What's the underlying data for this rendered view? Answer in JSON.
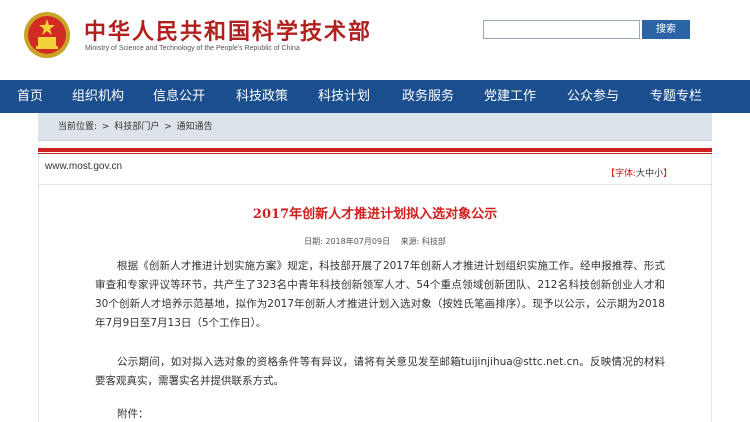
{
  "header": {
    "title": "中华人民共和国科学技术部",
    "subtitle": "Ministry of Science and Technology of the People's Republic of China",
    "search_placeholder": "",
    "search_button": "搜索"
  },
  "nav": {
    "items": [
      {
        "label": "首页"
      },
      {
        "label": "组织机构"
      },
      {
        "label": "信息公开"
      },
      {
        "label": "科技政策"
      },
      {
        "label": "科技计划"
      },
      {
        "label": "政务服务"
      },
      {
        "label": "党建工作"
      },
      {
        "label": "公众参与"
      },
      {
        "label": "专题专栏"
      }
    ]
  },
  "breadcrumb": {
    "prefix": "当前位置:",
    "items": [
      "科技部门户",
      "通知通告"
    ],
    "separator": ">"
  },
  "page": {
    "site_url": "www.most.gov.cn",
    "font_size_label": "【字体:",
    "font_big": "大",
    "font_medium": "中",
    "font_small": "小",
    "font_close": "】"
  },
  "article": {
    "title": "2017年创新人才推进计划拟入选对象公示",
    "date": "日期: 2018年07月09日",
    "source": "来源: 科技部",
    "paragraph1": "根据《创新人才推进计划实施方案》规定，科技部开展了2017年创新人才推进计划组织实施工作。经申报推荐、形式审查和专家评议等环节，共产生了323名中青年科技创新领军人才、54个重点领域创新团队、212名科技创新创业人才和30个创新人才培养示范基地，拟作为2017年创新人才推进计划入选对象（按姓氏笔画排序）。现予以公示，公示期为2018年7月9日至7月13日（5个工作日）。",
    "paragraph2": "公示期间，如对拟入选对象的资格条件等有异议，请将有关意见发至邮箱tuijinjihua@sttc.net.cn。反映情况的材料要客观真实，需署实名并提供联系方式。",
    "attachment_label": "附件："
  },
  "colors": {
    "brand_red": "#b0211e",
    "nav_blue": "#1b4e8e",
    "accent_red": "#cf1f1f"
  }
}
